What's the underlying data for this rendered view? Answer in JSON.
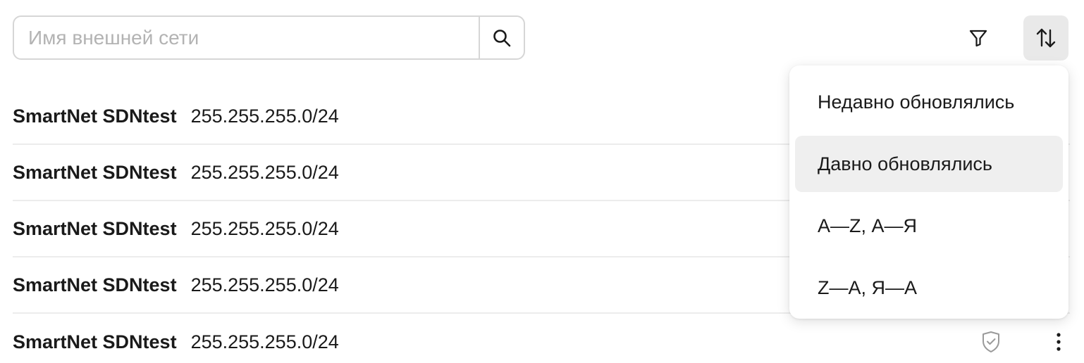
{
  "search": {
    "placeholder": "Имя внешней сети",
    "value": ""
  },
  "toolbar": {
    "search_icon": "search-icon",
    "filter_icon": "filter-icon",
    "sort_icon": "sort-arrows-icon"
  },
  "networks": [
    {
      "name": "SmartNet SDNtest",
      "cidr": "255.255.255.0/24"
    },
    {
      "name": "SmartNet SDNtest",
      "cidr": "255.255.255.0/24"
    },
    {
      "name": "SmartNet SDNtest",
      "cidr": "255.255.255.0/24"
    },
    {
      "name": "SmartNet SDNtest",
      "cidr": "255.255.255.0/24"
    },
    {
      "name": "SmartNet SDNtest",
      "cidr": "255.255.255.0/24",
      "shield_icon": "shield-check-icon",
      "menu_icon": "kebab-menu-icon"
    }
  ],
  "sort_menu": {
    "items": [
      {
        "label": "Недавно обновлялись",
        "selected": false
      },
      {
        "label": "Давно обновлялись",
        "selected": true
      },
      {
        "label": "A—Z, А—Я",
        "selected": false
      },
      {
        "label": "Z—A, Я—А",
        "selected": false
      }
    ]
  },
  "colors": {
    "border": "#d6d6d6",
    "divider": "#ececec",
    "selected_bg": "#efefef",
    "sort_button_bg": "#e9e9e9",
    "placeholder": "#b3b3b3",
    "text": "#1a1a1a"
  }
}
